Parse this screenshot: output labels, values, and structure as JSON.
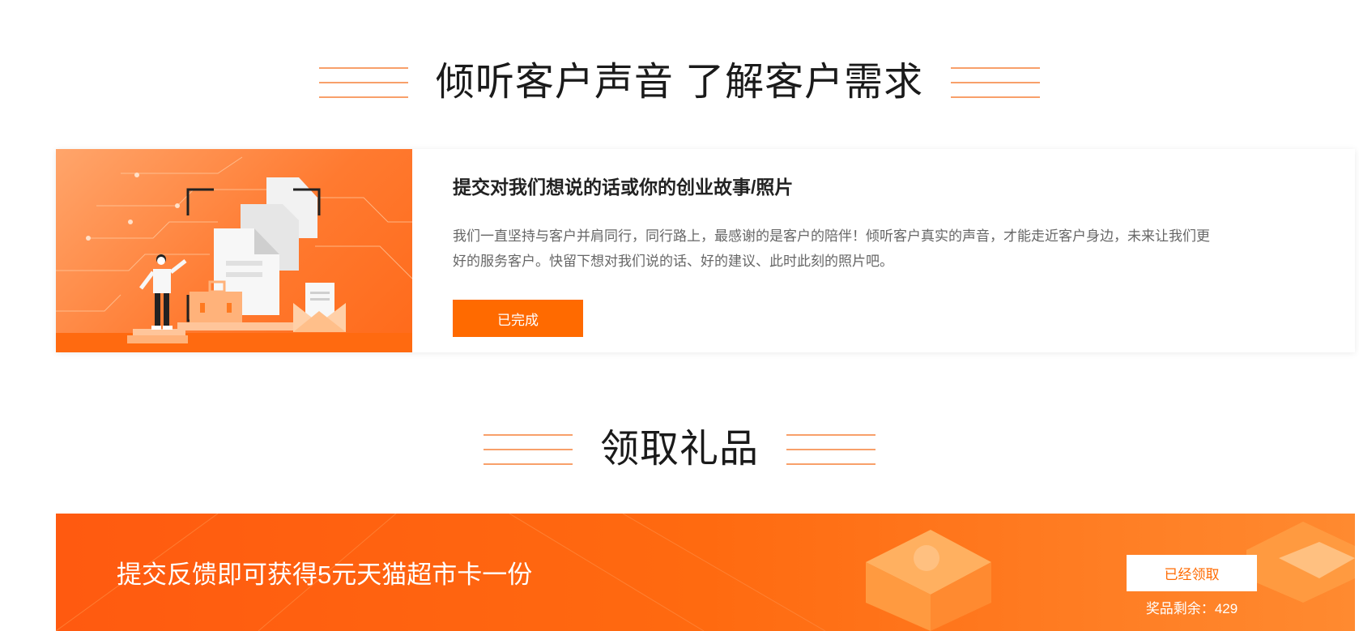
{
  "section1": {
    "title": "倾听客户声音 了解客户需求"
  },
  "feedback_card": {
    "heading": "提交对我们想说的话或你的创业故事/照片",
    "description": "我们一直坚持与客户并肩同行，同行路上，最感谢的是客户的陪伴！倾听客户真实的声音，才能走近客户身边，未来让我们更好的服务客户。快留下想对我们说的话、好的建议、此时此刻的照片吧。",
    "button_label": "已完成"
  },
  "section2": {
    "title": "领取礼品"
  },
  "gift_banner": {
    "text": "提交反馈即可获得5元天猫超市卡一份",
    "button_label": "已经领取",
    "remaining_label": "奖品剩余：",
    "remaining_count": "429"
  },
  "colors": {
    "accent": "#ff6a00",
    "title_line": "#f8a06a"
  }
}
